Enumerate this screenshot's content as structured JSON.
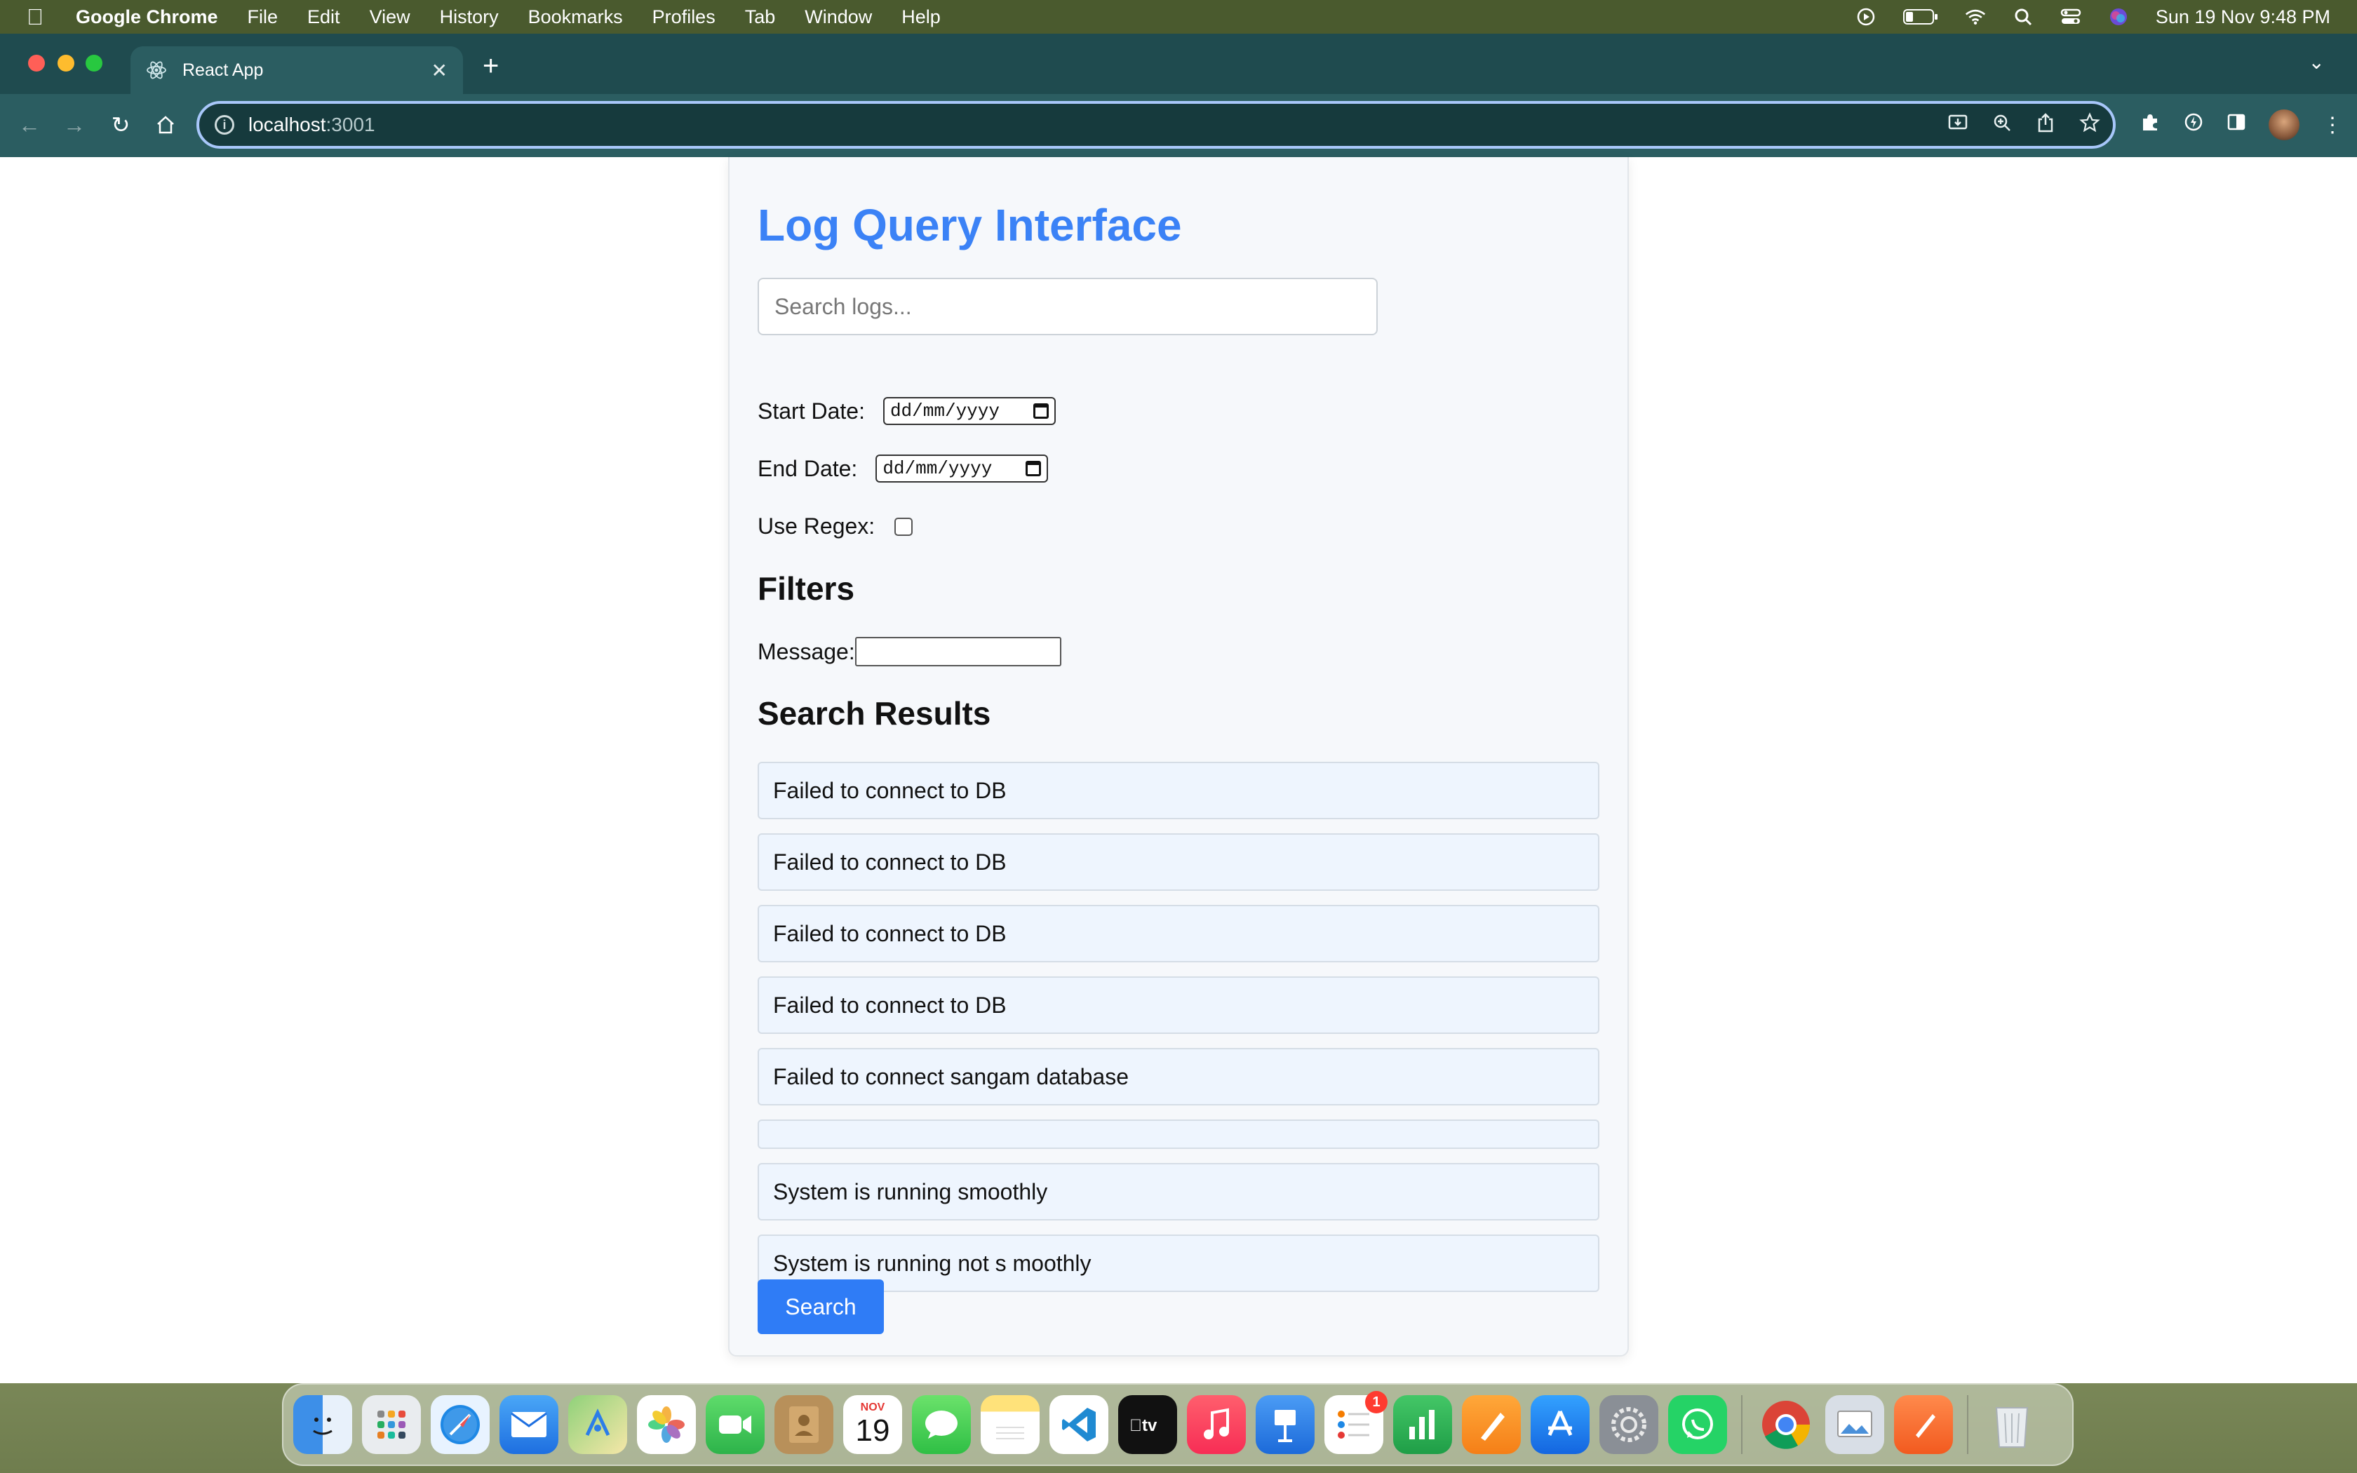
{
  "menubar": {
    "app_name": "Google Chrome",
    "items": [
      "File",
      "Edit",
      "View",
      "History",
      "Bookmarks",
      "Profiles",
      "Tab",
      "Window",
      "Help"
    ],
    "clock": "Sun 19 Nov  9:48 PM"
  },
  "browser": {
    "tab_title": "React App",
    "url_host": "localhost",
    "url_rest": ":3001"
  },
  "page": {
    "title": "Log Query Interface",
    "search_placeholder": "Search logs...",
    "start_date_label": "Start Date:",
    "end_date_label": "End Date:",
    "date_placeholder": "dd/mm/yyyy",
    "regex_label": "Use Regex:",
    "filters_heading": "Filters",
    "message_label": "Message:",
    "results_heading": "Search Results",
    "results": [
      "Failed to connect to DB",
      "Failed to connect to DB",
      "Failed to connect to DB",
      "Failed to connect to DB",
      "Failed to connect sangam database",
      "",
      "System is running smoothly",
      "System is running not s moothly"
    ],
    "search_button": "Search"
  },
  "dock": {
    "calendar_month": "NOV",
    "calendar_day": "19",
    "reminders_badge": "1",
    "apps": [
      "finder",
      "launchpad",
      "safari",
      "mail",
      "maps",
      "photos",
      "facetime",
      "contacts",
      "calendar",
      "messages",
      "notes",
      "vscode",
      "tv",
      "music",
      "keynote",
      "reminders",
      "numbers",
      "pages",
      "app-store",
      "system-settings",
      "whatsapp",
      "chrome",
      "preview",
      "sketch-app",
      "trash"
    ]
  }
}
